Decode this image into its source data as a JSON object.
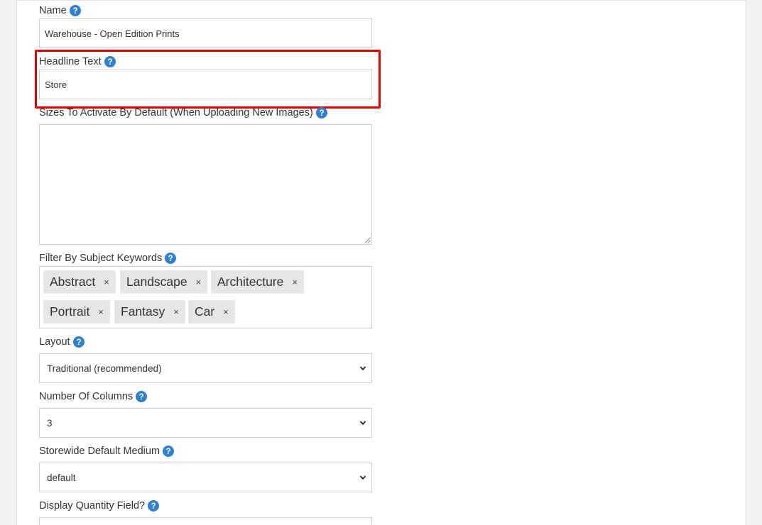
{
  "fields": {
    "name": {
      "label": "Name",
      "value": "Warehouse - Open Edition Prints"
    },
    "headline": {
      "label": "Headline Text",
      "value": "Store"
    },
    "sizes": {
      "label": "Sizes To Activate By Default (When Uploading New Images)",
      "value": ""
    },
    "keywords": {
      "label": "Filter By Subject Keywords",
      "tags": [
        "Abstract",
        "Landscape",
        "Architecture",
        "Portrait",
        "Fantasy",
        "Car"
      ],
      "remove_glyph": "×"
    },
    "layout": {
      "label": "Layout",
      "selected": "Traditional (recommended)"
    },
    "columns": {
      "label": "Number Of Columns",
      "selected": "3"
    },
    "medium": {
      "label": "Storewide Default Medium",
      "selected": "default"
    },
    "quantity": {
      "label": "Display Quantity Field?"
    }
  },
  "colors": {
    "help_icon": "#2f80d1",
    "highlight": "#e00000",
    "tag_bg": "#e6e6e6",
    "border": "#cfcfcf"
  },
  "icons": {
    "help": "question-circle-icon",
    "select": "chevron-down-icon",
    "tag_remove": "close-icon"
  }
}
